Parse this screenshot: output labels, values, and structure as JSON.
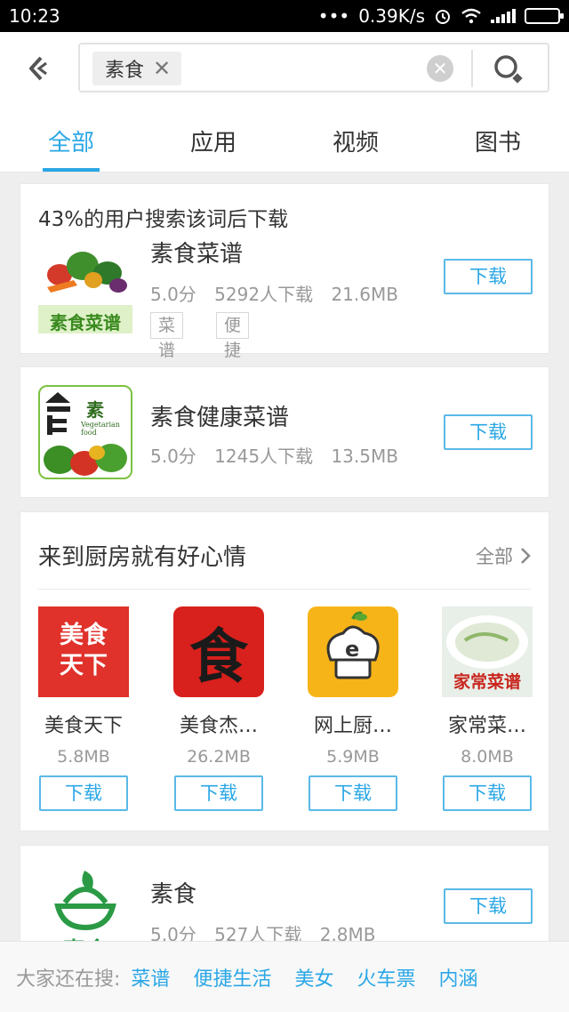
{
  "status_bar": {
    "time": "10:23",
    "network_speed": "0.39K/s"
  },
  "search": {
    "query": "素食"
  },
  "tabs": [
    {
      "label": "全部",
      "active": true
    },
    {
      "label": "应用",
      "active": false
    },
    {
      "label": "视频",
      "active": false
    },
    {
      "label": "图书",
      "active": false
    }
  ],
  "top_result": {
    "hint": "43%的用户搜索该词后下载",
    "name": "素食菜谱",
    "rating": "5.0分",
    "downloads": "5292人下载",
    "size": "21.6MB",
    "tags": [
      "菜谱",
      "便捷生活"
    ],
    "button": "下载",
    "icon_text": "素食菜谱"
  },
  "result2": {
    "name": "素食健康菜谱",
    "rating": "5.0分",
    "downloads": "1245人下载",
    "size": "13.5MB",
    "button": "下载",
    "icon_text": "素",
    "icon_subtext": "Vegetarian food"
  },
  "section": {
    "title": "来到厨房就有好心情",
    "more": "全部",
    "apps": [
      {
        "name": "美食天下",
        "size": "5.8MB",
        "button": "下载",
        "icon_line1": "美食",
        "icon_line2": "天下"
      },
      {
        "name": "美食杰…",
        "size": "26.2MB",
        "button": "下载",
        "icon_text": "食"
      },
      {
        "name": "网上厨…",
        "size": "5.9MB",
        "button": "下载",
        "icon_text": "e"
      },
      {
        "name": "家常菜…",
        "size": "8.0MB",
        "button": "下载",
        "icon_text": "家常菜谱"
      }
    ]
  },
  "result3": {
    "name": "素食",
    "rating": "5.0分",
    "downloads": "527人下载",
    "size": "2.8MB",
    "button": "下载",
    "icon_text": "素食"
  },
  "bottom": {
    "label": "大家还在搜:",
    "keywords": [
      "菜谱",
      "便捷生活",
      "美女",
      "火车票",
      "内涵"
    ]
  },
  "colors": {
    "accent": "#2aa7e6"
  }
}
